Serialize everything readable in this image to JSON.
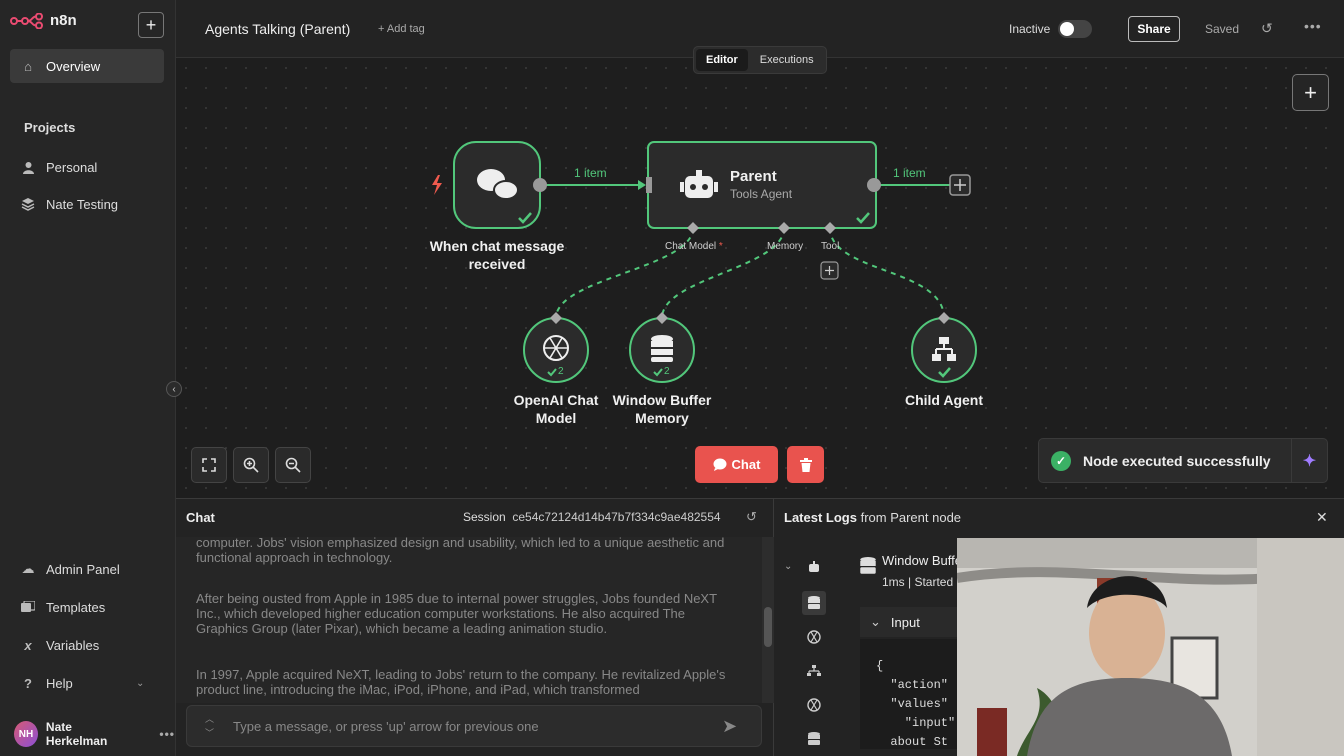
{
  "app": {
    "brand": "n8n"
  },
  "sidebar": {
    "overview": "Overview",
    "projects_heading": "Projects",
    "projects": [
      "Personal",
      "Nate Testing"
    ],
    "bottom": [
      "Admin Panel",
      "Templates",
      "Variables",
      "Help"
    ],
    "user": {
      "initials": "NH",
      "name": "Nate Herkelman"
    }
  },
  "header": {
    "title": "Agents Talking (Parent)",
    "add_tag": "+ Add tag",
    "status": "Inactive",
    "share": "Share",
    "saved": "Saved"
  },
  "tabs": {
    "editor": "Editor",
    "executions": "Executions"
  },
  "nodes": {
    "trigger": "When chat message received",
    "parent_title": "Parent",
    "parent_subtitle": "Tools Agent",
    "openai": "OpenAI Chat Model",
    "memory": "Window Buffer Memory",
    "child": "Child Agent",
    "chat_model_label": "Chat Model",
    "memory_label": "Memory",
    "tool_label": "Tool",
    "item_count_1": "1 item",
    "item_count_2": "1 item",
    "run_count_openai": "2",
    "run_count_memory": "2"
  },
  "canvas": {
    "chat_button": "Chat",
    "toast": "Node executed successfully"
  },
  "chat": {
    "title": "Chat",
    "session_label": "Session",
    "session_id": "ce54c72124d14b47b7f334c9ae482554",
    "messages": [
      "computer. Jobs' vision emphasized design and usability, which led to a unique aesthetic and functional approach in technology.",
      "After being ousted from Apple in 1985 due to internal power struggles, Jobs founded NeXT Inc., which developed higher education computer workstations. He also acquired The Graphics Group (later Pixar), which became a leading animation studio.",
      "In 1997, Apple acquired NeXT, leading to Jobs' return to the company. He revitalized Apple's product line, introducing the iMac, iPod, iPhone, and iPad, which transformed"
    ],
    "placeholder": "Type a message, or press 'up' arrow for previous one"
  },
  "logs": {
    "title_bold": "Latest Logs",
    "title_rest": "from Parent node",
    "entry_name": "Window Buffer Memory",
    "entry_meta": "1ms | Started",
    "input_label": "Input",
    "json_lines": [
      "{",
      "  \"action\"",
      "  \"values\"",
      "    \"input\"",
      "  about St"
    ]
  },
  "colors": {
    "success": "#52c77b",
    "accent_red": "#e9534e",
    "trigger": "#ef5a4e"
  }
}
